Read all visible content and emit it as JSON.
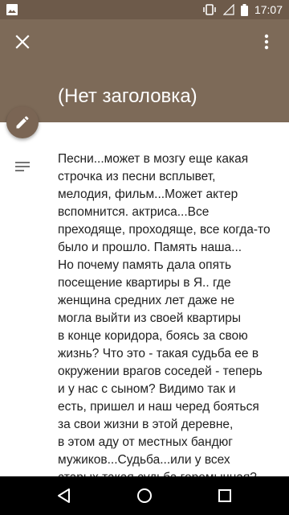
{
  "status_bar": {
    "time": "17:07",
    "icons": [
      "image-icon",
      "vibrate-icon",
      "signal-icon",
      "battery-icon"
    ]
  },
  "header": {
    "title": "(Нет заголовка)",
    "close_icon": "close-icon",
    "more_icon": "more-vert-icon",
    "edit_icon": "pencil-icon"
  },
  "note": {
    "notes_icon": "notes-icon",
    "lines": [
      "Песни...может в мозгу еще какая",
      "строчка из песни всплывет,",
      "мелодия, фильм...Может актер",
      "вспомнится. актриса...Все",
      "преходяще, проходяще, все когда-то",
      "было и прошло. Память наша...",
      "Но почему память дала опять",
      "посещение квартиры в Я.. где",
      "женщина средних лет даже не",
      "могла выйти из своей квартиры",
      "в конце коридора, боясь за свою",
      "жизнь? Что это - такая судьба ее в",
      "окружении врагов соседей - теперь",
      "и у нас с сыном? Видимо так и",
      "есть, пришел и наш черед бояться",
      "за свои жизни в этой деревне,",
      "в этом аду от местных бандюг",
      "мужиков...Судьба...или у всех",
      "старых такая судьба горемычная?..."
    ]
  },
  "nav_bar": {
    "icons": [
      "back-icon",
      "home-icon",
      "recents-icon"
    ]
  },
  "colors": {
    "status_bar": "#6d5a4a",
    "app_bar": "#7d6a58",
    "fab": "#7a6554",
    "text": "#212121"
  }
}
